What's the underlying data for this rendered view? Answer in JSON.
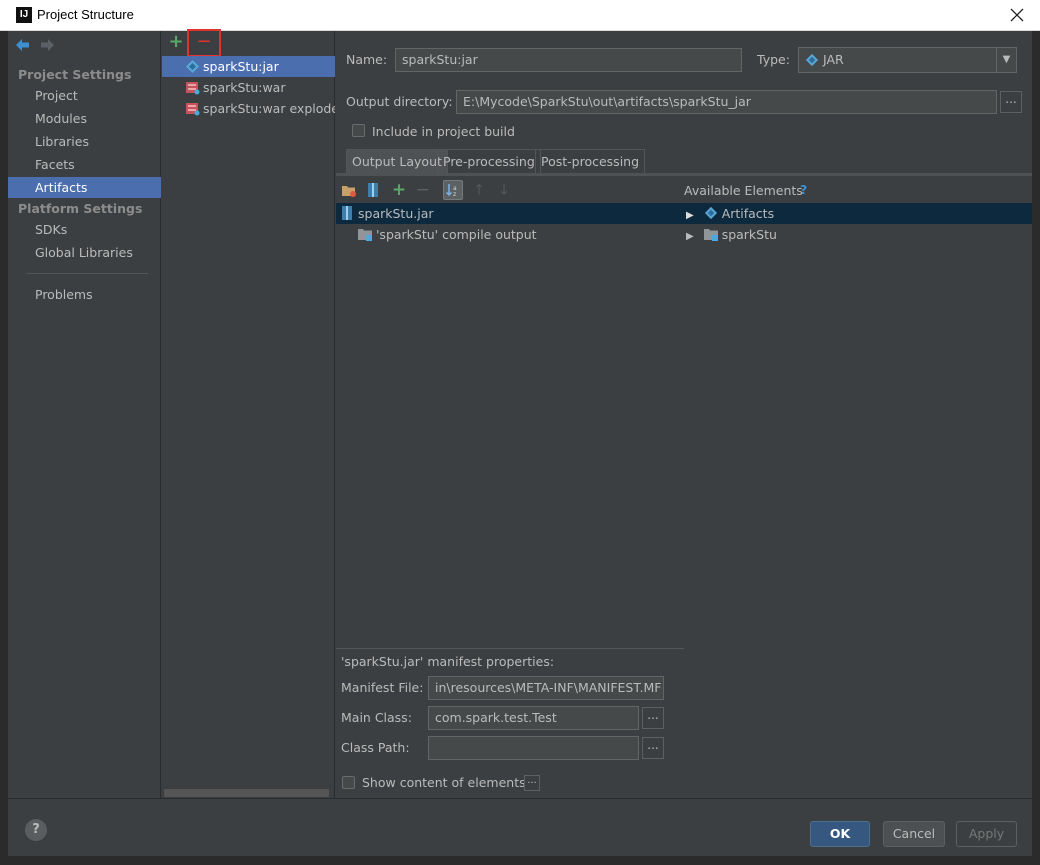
{
  "window": {
    "title": "Project Structure",
    "app_icon": "IJ"
  },
  "sidebar": {
    "project_settings_title": "Project Settings",
    "platform_settings_title": "Platform Settings",
    "items": {
      "project": "Project",
      "modules": "Modules",
      "libraries": "Libraries",
      "facets": "Facets",
      "artifacts": "Artifacts",
      "sdks": "SDKs",
      "global_libraries": "Global Libraries",
      "problems": "Problems"
    },
    "selected": "Artifacts"
  },
  "artifacts_list": {
    "add_label": "+",
    "remove_label": "−",
    "items": [
      {
        "label": "sparkStu:jar",
        "icon": "jar-icon",
        "selected": true
      },
      {
        "label": "sparkStu:war",
        "icon": "war-icon",
        "selected": false
      },
      {
        "label": "sparkStu:war exploded",
        "icon": "war-exploded-icon",
        "selected": false
      }
    ]
  },
  "form": {
    "name_label": "Name:",
    "name_value": "sparkStu:jar",
    "type_label": "Type:",
    "type_value": "JAR",
    "output_dir_label": "Output directory:",
    "output_dir_value": "E:\\Mycode\\SparkStu\\out\\artifacts\\sparkStu_jar",
    "browse_label": "...",
    "include_build_label": "Include in project build",
    "include_build_checked": false
  },
  "tabs": [
    "Output Layout",
    "Pre-processing",
    "Post-processing"
  ],
  "active_tab": "Output Layout",
  "layout": {
    "available_elements_label": "Available Elements",
    "help_mark": "?",
    "tree_left": [
      {
        "label": "sparkStu.jar",
        "icon": "jar-archive-icon"
      },
      {
        "label": "'sparkStu' compile output",
        "icon": "module-output-icon"
      }
    ],
    "tree_right": [
      {
        "label": "Artifacts",
        "icon": "artifact-icon"
      },
      {
        "label": "sparkStu",
        "icon": "module-folder-icon"
      }
    ]
  },
  "manifest": {
    "title": "'sparkStu.jar' manifest properties:",
    "manifest_file_label": "Manifest File:",
    "manifest_file_value": "in\\resources\\META-INF\\MANIFEST.MF",
    "main_class_label": "Main Class:",
    "main_class_value": "com.spark.test.Test",
    "class_path_label": "Class Path:",
    "class_path_value": "",
    "show_content_label": "Show content of elements",
    "browse_label": "..."
  },
  "buttons": {
    "help": "?",
    "ok": "OK",
    "cancel": "Cancel",
    "apply": "Apply"
  },
  "colors": {
    "selection": "#4b6eaf",
    "background": "#3c3f41",
    "add_green": "#59a869",
    "remove_red": "#e0332f",
    "highlight_box": "#e0332f"
  }
}
